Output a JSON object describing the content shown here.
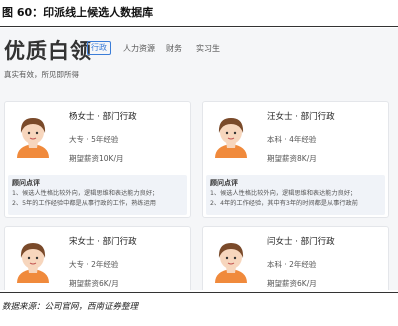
{
  "figure": {
    "title": "图 60：印派线上候选人数据库",
    "source": "数据来源：公司官网，西南证券整理"
  },
  "header": {
    "brand": "优质白领",
    "tabs": [
      {
        "label": "行政",
        "active": true
      },
      {
        "label": "人力资源",
        "active": false
      },
      {
        "label": "财务",
        "active": false
      },
      {
        "label": "实习生",
        "active": false
      }
    ],
    "tagline": "真实有效，所见即所得"
  },
  "colors": {
    "accent": "#3b7dd8",
    "skin": "#f7d6bd",
    "hair": "#7a4a2a",
    "shirt": "#f08a3c"
  },
  "cards": [
    {
      "name": "杨女士 · 部门行政",
      "edu": "大专 · 5年经验",
      "salary": "期望薪资10K/月",
      "review_title": "顾问点评",
      "review_lines": [
        "1、候选人性格比较外向，逻辑思维和表达能力良好；",
        "2、5年的工作经验中都是从事行政的工作，熟练运用"
      ]
    },
    {
      "name": "汪女士 · 部门行政",
      "edu": "本科 · 4年经验",
      "salary": "期望薪资8K/月",
      "review_title": "顾问点评",
      "review_lines": [
        "1、候选人性格比较外向，逻辑思维和表达能力良好；",
        "2、4年的工作经验，其中有3年的时间都是从事行政前"
      ]
    },
    {
      "name": "宋女士 · 部门行政",
      "edu": "大专 · 2年经验",
      "salary": "期望薪资6K/月"
    },
    {
      "name": "闫女士 · 部门行政",
      "edu": "本科 · 2年经验",
      "salary": "期望薪资6K/月"
    }
  ]
}
